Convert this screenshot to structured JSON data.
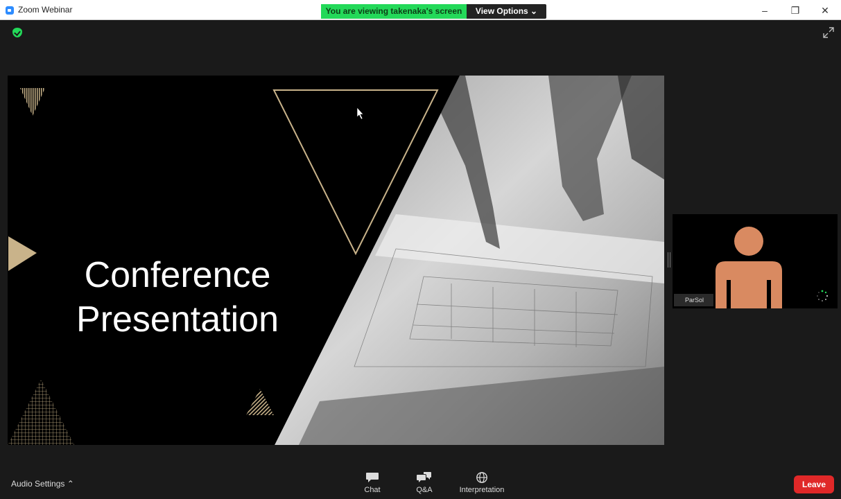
{
  "window": {
    "title": "Zoom Webinar",
    "minimize": "–",
    "restore": "❐",
    "close": "✕"
  },
  "banner": {
    "viewing_text": "You are viewing takenaka's screen",
    "view_options": "View Options ⌄"
  },
  "slide": {
    "title_line1": "Conference",
    "title_line2": "Presentation"
  },
  "participant": {
    "name": "ParSol"
  },
  "toolbar": {
    "audio_settings": "Audio Settings ⌃",
    "chat": "Chat",
    "qa": "Q&A",
    "interpretation": "Interpretation",
    "leave": "Leave"
  },
  "colors": {
    "banner_green": "#23d959",
    "leave_red": "#e02828",
    "gold": "#c9b38a",
    "avatar": "#d98a61"
  },
  "icons": {
    "security": "shield-check-icon",
    "fullscreen": "expand-icon",
    "chat": "chat-bubble-icon",
    "qa": "qa-bubbles-icon",
    "interpretation": "globe-icon",
    "loading": "spinner-icon"
  }
}
